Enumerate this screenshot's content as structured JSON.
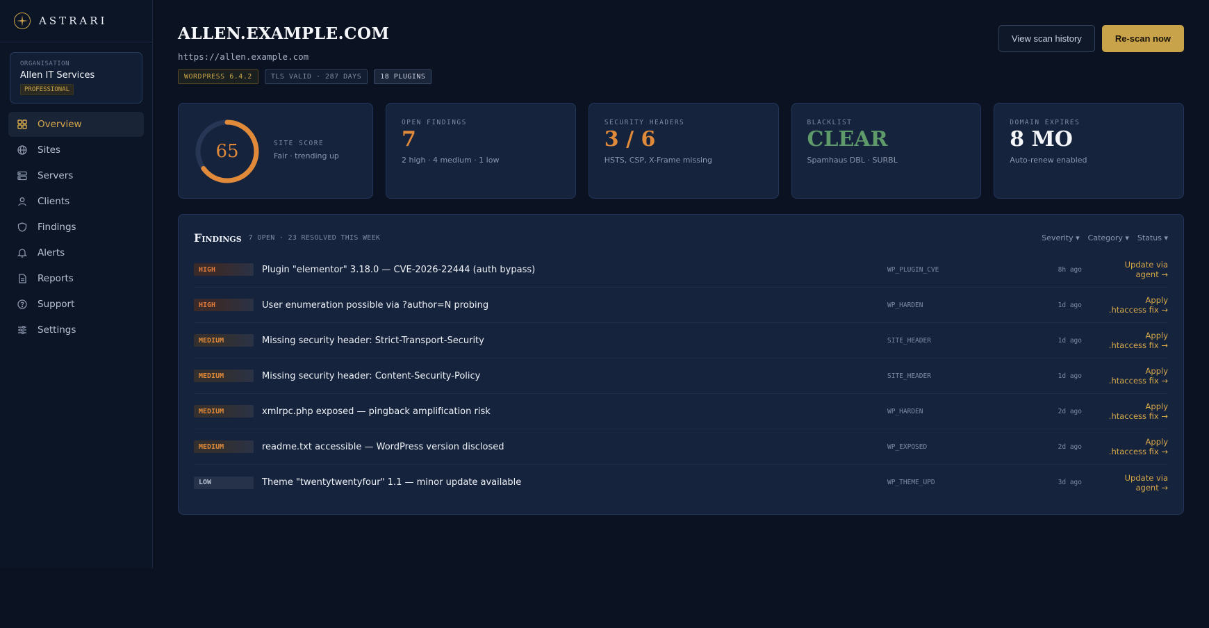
{
  "brand": {
    "name": "ASTRARI"
  },
  "org": {
    "label": "ORGANISATION",
    "name": "Allen IT Services",
    "plan": "PROFESSIONAL"
  },
  "nav": [
    {
      "label": "Overview",
      "icon": "grid-icon"
    },
    {
      "label": "Sites",
      "icon": "globe-icon"
    },
    {
      "label": "Servers",
      "icon": "server-icon"
    },
    {
      "label": "Clients",
      "icon": "user-icon"
    },
    {
      "label": "Findings",
      "icon": "shield-icon"
    },
    {
      "label": "Alerts",
      "icon": "bell-icon"
    },
    {
      "label": "Reports",
      "icon": "document-icon"
    },
    {
      "label": "Support",
      "icon": "help-icon"
    },
    {
      "label": "Settings",
      "icon": "sliders-icon"
    }
  ],
  "site": {
    "title": "ALLEN.EXAMPLE.COM",
    "url": "https://allen.example.com",
    "chips": [
      "WORDPRESS 6.4.2",
      "TLS VALID · 287 DAYS",
      "18 PLUGINS"
    ]
  },
  "actions": {
    "history": "View scan history",
    "rescan": "Re-scan now"
  },
  "score": {
    "value": "65",
    "fraction": 0.65,
    "label": "SITE SCORE",
    "sub": "Fair · trending up"
  },
  "stats": [
    {
      "label": "OPEN FINDINGS",
      "value": "7",
      "sub": "2 high · 4 medium · 1 low",
      "color": "#e08a3a"
    },
    {
      "label": "SECURITY HEADERS",
      "value": "3 / 6",
      "sub": "HSTS, CSP, X-Frame missing",
      "color": "#e08a3a"
    },
    {
      "label": "BLACKLIST",
      "value": "CLEAR",
      "sub": "Spamhaus DBL · SURBL",
      "color": "#5f9a6a"
    },
    {
      "label": "DOMAIN EXPIRES",
      "value": "8 MO",
      "sub": "Auto-renew enabled",
      "color": "#f5f6f9"
    }
  ],
  "findings": {
    "title": "Findings",
    "meta": "7 OPEN · 23 RESOLVED THIS WEEK",
    "filters": [
      "Severity ▾",
      "Category ▾",
      "Status ▾"
    ],
    "rows": [
      {
        "severity": "HIGH",
        "level": "high",
        "desc": "Plugin \"elementor\" 3.18.0 — CVE-2026-22444 (auth bypass)",
        "category": "WP_PLUGIN_CVE",
        "time": "8h ago",
        "action1": "Update via",
        "action2": "agent →"
      },
      {
        "severity": "HIGH",
        "level": "high",
        "desc": "User enumeration possible via ?author=N probing",
        "category": "WP_HARDEN",
        "time": "1d ago",
        "action1": "Apply",
        "action2": ".htaccess fix →"
      },
      {
        "severity": "MEDIUM",
        "level": "medium",
        "desc": "Missing security header: Strict-Transport-Security",
        "category": "SITE_HEADER",
        "time": "1d ago",
        "action1": "Apply",
        "action2": ".htaccess fix →"
      },
      {
        "severity": "MEDIUM",
        "level": "medium",
        "desc": "Missing security header: Content-Security-Policy",
        "category": "SITE_HEADER",
        "time": "1d ago",
        "action1": "Apply",
        "action2": ".htaccess fix →"
      },
      {
        "severity": "MEDIUM",
        "level": "medium",
        "desc": "xmlrpc.php exposed — pingback amplification risk",
        "category": "WP_HARDEN",
        "time": "2d ago",
        "action1": "Apply",
        "action2": ".htaccess fix →"
      },
      {
        "severity": "MEDIUM",
        "level": "medium",
        "desc": "readme.txt accessible — WordPress version disclosed",
        "category": "WP_EXPOSED",
        "time": "2d ago",
        "action1": "Apply",
        "action2": ".htaccess fix →"
      },
      {
        "severity": "LOW",
        "level": "low",
        "desc": "Theme \"twentytwentyfour\" 1.1 — minor update available",
        "category": "WP_THEME_UPD",
        "time": "3d ago",
        "action1": "Update via",
        "action2": "agent →"
      }
    ]
  },
  "colors": {
    "accent": "#c9a34a",
    "high": "#e07a3a",
    "clear": "#5f9a6a"
  }
}
